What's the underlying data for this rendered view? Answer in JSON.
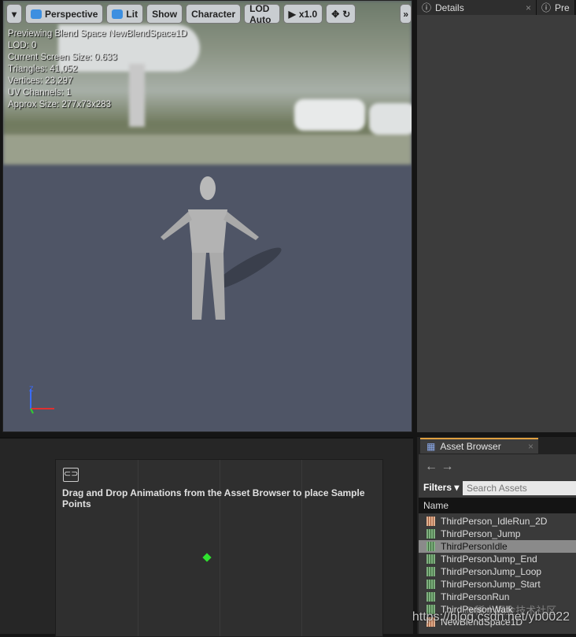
{
  "toolbar": {
    "perspective": "Perspective",
    "lit": "Lit",
    "show": "Show",
    "character": "Character",
    "lod": "LOD Auto",
    "speed": "x1.0"
  },
  "stats": [
    "Previewing Blend Space NewBlendSpace1D",
    "LOD: 0",
    "Current Screen Size: 0.633",
    "Triangles: 41,052",
    "Vertices: 23,297",
    "UV Channels: 1",
    "Approx Size: 277x73x283"
  ],
  "right_tabs": {
    "details": "Details",
    "preview": "Pre"
  },
  "blend_editor": {
    "hint": "Drag and Drop Animations from the Asset Browser to place Sample Points"
  },
  "asset_browser": {
    "tab": "Asset Browser",
    "filters": "Filters",
    "search_placeholder": "Search Assets",
    "column": "Name",
    "items": [
      "ThirdPerson_IdleRun_2D",
      "ThirdPerson_Jump",
      "ThirdPersonIdle",
      "ThirdPersonJump_End",
      "ThirdPersonJump_Loop",
      "ThirdPersonJump_Start",
      "ThirdPersonRun",
      "ThirdPersonWalk",
      "NewBlendSpace1D"
    ],
    "selected": "ThirdPersonIdle"
  },
  "watermark": {
    "url": "https://blog.csdn.net/yb0022",
    "site": "@稀土掘金技术社区"
  }
}
